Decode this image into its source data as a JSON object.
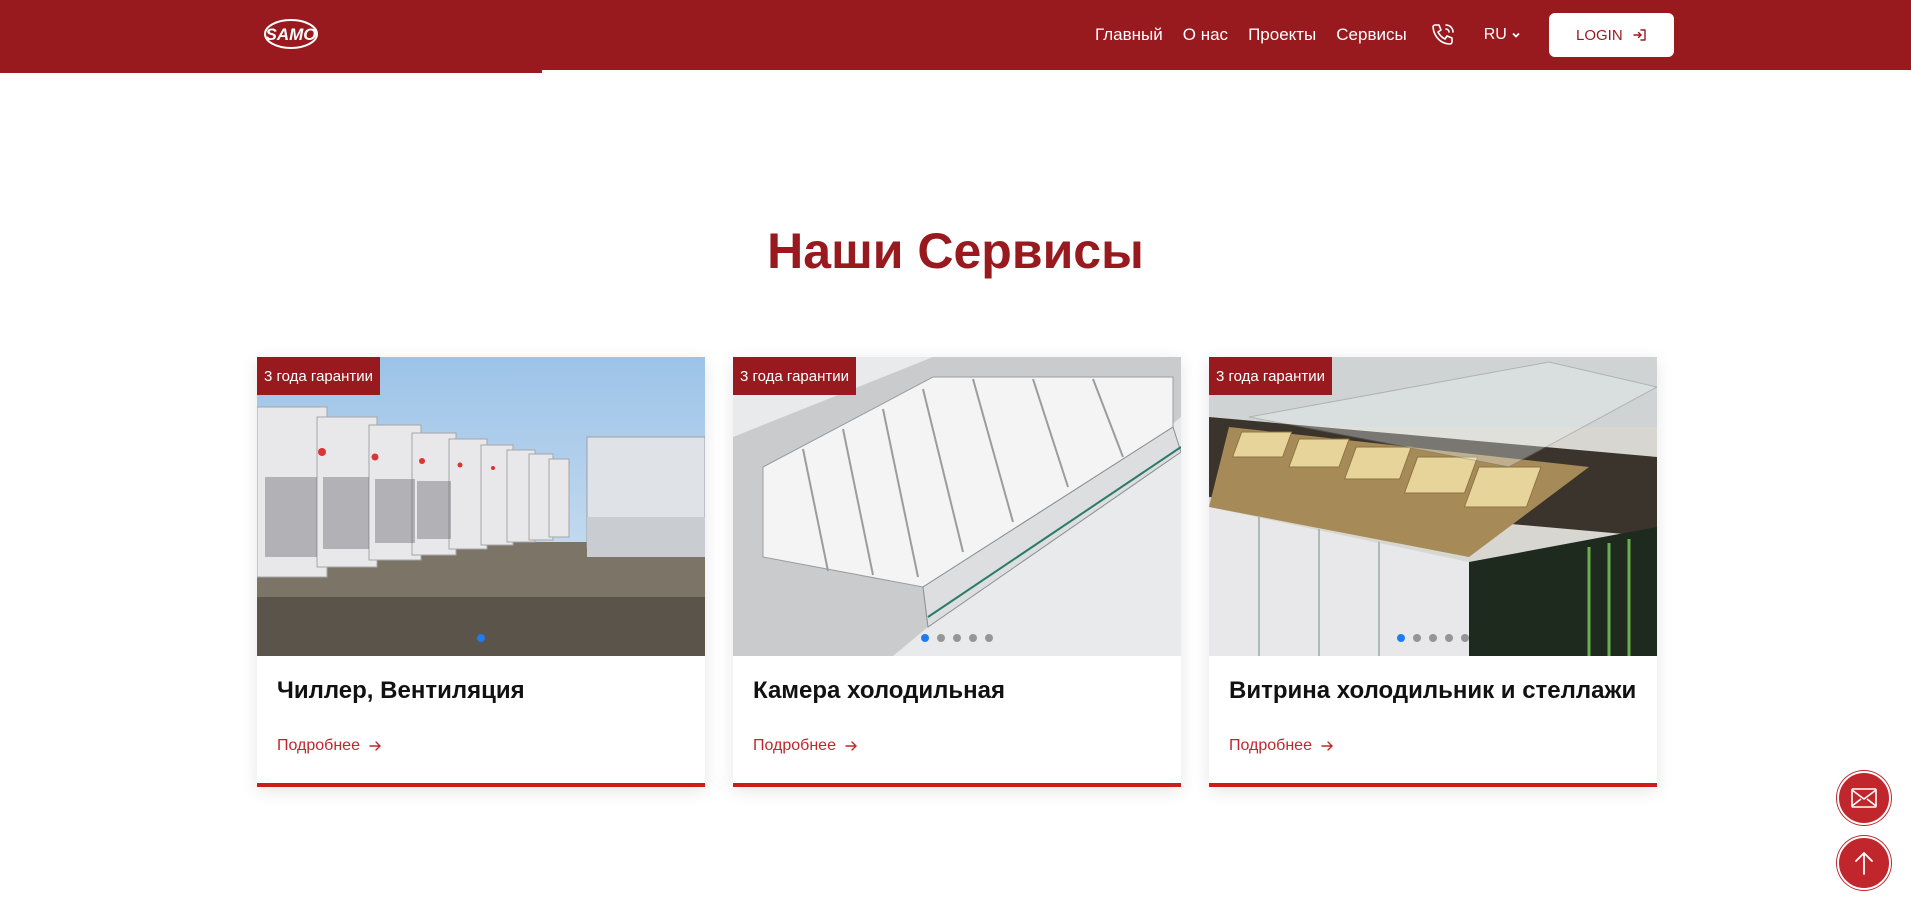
{
  "header": {
    "logo_text": "SAMO",
    "nav": [
      "Главный",
      "О нас",
      "Проекты",
      "Сервисы"
    ],
    "lang": "RU",
    "login_label": "LOGIN"
  },
  "section": {
    "title": "Наши Сервисы"
  },
  "cards": [
    {
      "badge": "3 года гарантии",
      "title": "Чиллер, Вентиляция",
      "more": "Подробнее"
    },
    {
      "badge": "3 года гарантии",
      "title": "Камера холодильная",
      "more": "Подробнее"
    },
    {
      "badge": "3 года гарантии",
      "title": "Витрина холодильник и стеллажи",
      "more": "Подробнее"
    }
  ],
  "colors": {
    "brand": "#981a1e",
    "accent": "#c0262c",
    "dot_active": "#1e7bf0"
  },
  "icons": [
    "phone-icon",
    "chevron-down-icon",
    "login-icon",
    "arrow-right-icon",
    "mail-icon",
    "arrow-up-icon"
  ]
}
